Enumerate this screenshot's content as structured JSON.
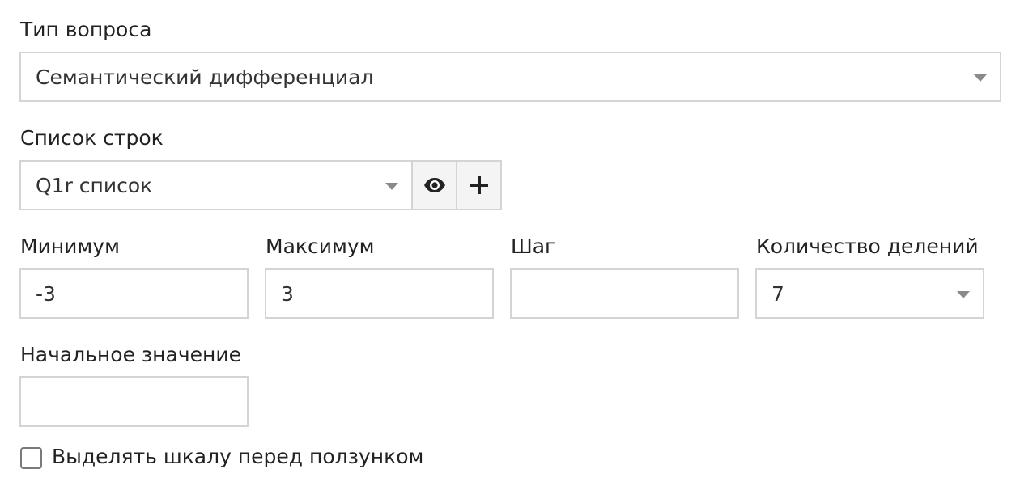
{
  "question_type": {
    "label": "Тип вопроса",
    "value": "Семантический дифференциал"
  },
  "row_list": {
    "label": "Список строк",
    "value": "Q1r список",
    "view_icon": "eye-icon",
    "add_icon": "plus-icon"
  },
  "minimum": {
    "label": "Минимум",
    "value": "-3"
  },
  "maximum": {
    "label": "Максимум",
    "value": "3"
  },
  "step": {
    "label": "Шаг",
    "value": ""
  },
  "divisions": {
    "label": "Количество делений",
    "value": "7"
  },
  "initial_value": {
    "label": "Начальное значение",
    "value": ""
  },
  "highlight_scale": {
    "label": "Выделять шкалу перед ползунком",
    "checked": false
  }
}
